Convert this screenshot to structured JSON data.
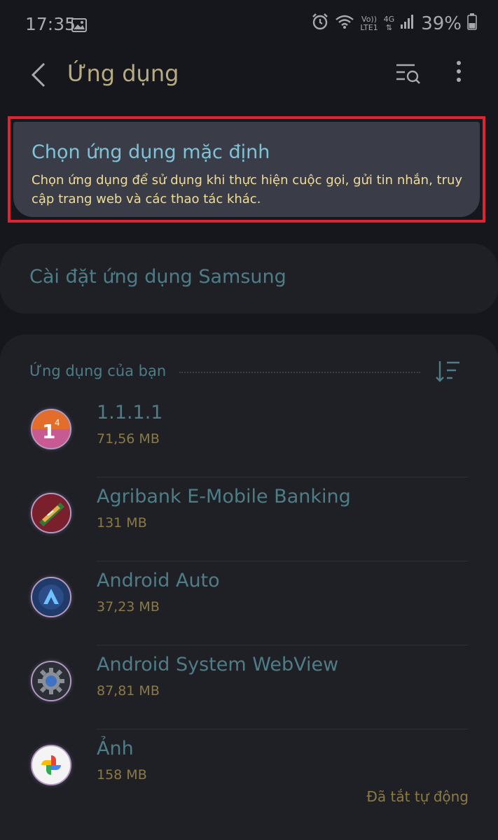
{
  "status_bar": {
    "time": "17:35",
    "network_top": "Vo))",
    "network_bottom": "LTE1",
    "network_type": "4G",
    "battery": "39%"
  },
  "header": {
    "title": "Ứng dụng"
  },
  "default_apps": {
    "title": "Chọn ứng dụng mặc định",
    "description": "Chọn ứng dụng để sử dụng khi thực hiện cuộc gọi, gửi tin nhắn, truy cập trang web và các thao tác khác."
  },
  "samsung_settings": {
    "label": "Cài đặt ứng dụng Samsung"
  },
  "apps_section": {
    "header": "Ứng dụng của bạn",
    "apps": [
      {
        "name": "1.1.1.1",
        "size": "71,56 MB",
        "status": ""
      },
      {
        "name": "Agribank E-Mobile Banking",
        "size": "131 MB",
        "status": ""
      },
      {
        "name": "Android Auto",
        "size": "37,23 MB",
        "status": ""
      },
      {
        "name": "Android System WebView",
        "size": "87,81 MB",
        "status": ""
      },
      {
        "name": "Ảnh",
        "size": "158 MB",
        "status": "Đã tắt tự động"
      }
    ]
  },
  "colors": {
    "background": "#15171c",
    "card": "#1e2026",
    "highlight_border": "#e0232e",
    "title_accent": "#7fc3d8",
    "description_text": "#f1dc9a"
  }
}
